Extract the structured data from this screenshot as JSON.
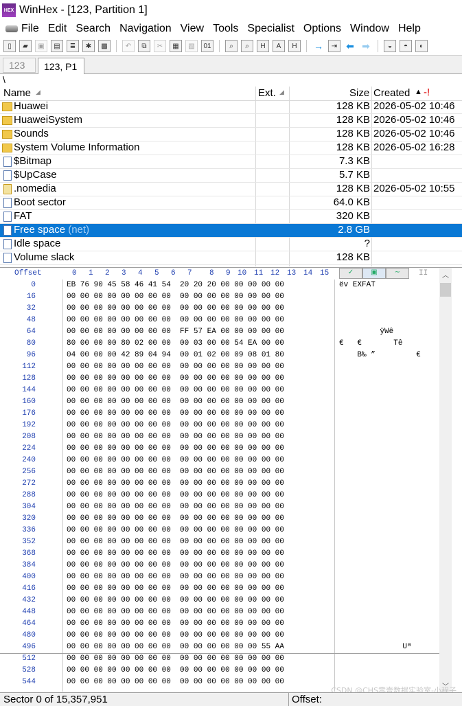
{
  "window": {
    "title": "WinHex - [123, Partition 1]",
    "app_icon_text": "HEX"
  },
  "menu": [
    "File",
    "Edit",
    "Search",
    "Navigation",
    "View",
    "Tools",
    "Specialist",
    "Options",
    "Window",
    "Help"
  ],
  "tabs": [
    {
      "label": "123",
      "active": false
    },
    {
      "label": "123, P1",
      "active": true
    }
  ],
  "path": "\\",
  "file_list": {
    "columns": {
      "name": "Name",
      "ext": "Ext.",
      "size": "Size",
      "created": "Created"
    },
    "rows": [
      {
        "name": "Huawei",
        "suffix": "",
        "size": "128 KB",
        "created": "2026-05-02  10:46",
        "icon": "folder-icon"
      },
      {
        "name": "HuaweiSystem",
        "suffix": "",
        "size": "128 KB",
        "created": "2026-05-02  10:46",
        "icon": "folder-icon"
      },
      {
        "name": "Sounds",
        "suffix": "",
        "size": "128 KB",
        "created": "2026-05-02  10:46",
        "icon": "folder-icon"
      },
      {
        "name": "System Volume Information",
        "suffix": "",
        "size": "128 KB",
        "created": "2026-05-02  16:28",
        "icon": "folder-icon"
      },
      {
        "name": "$Bitmap",
        "suffix": "",
        "size": "7.3 KB",
        "created": "",
        "icon": "file-icon"
      },
      {
        "name": "$UpCase",
        "suffix": "",
        "size": "5.7 KB",
        "created": "",
        "icon": "file-icon"
      },
      {
        "name": ".nomedia",
        "suffix": "",
        "size": "128 KB",
        "created": "2026-05-02  10:55",
        "icon": "nomedia-file-icon"
      },
      {
        "name": "Boot sector",
        "suffix": "",
        "size": "64.0 KB",
        "created": "",
        "icon": "file-icon"
      },
      {
        "name": "FAT",
        "suffix": "",
        "size": "320 KB",
        "created": "",
        "icon": "file-icon"
      },
      {
        "name": "Free space",
        "suffix": "(net)",
        "size": "2.8 GB",
        "created": "",
        "icon": "file-icon",
        "selected": true
      },
      {
        "name": "Idle space",
        "suffix": "",
        "size": "?",
        "created": "",
        "icon": "file-icon"
      },
      {
        "name": "Volume slack",
        "suffix": "",
        "size": "128 KB",
        "created": "",
        "icon": "file-icon"
      }
    ]
  },
  "hex": {
    "offset_label": "Offset",
    "column_labels": [
      "0",
      "1",
      "2",
      "3",
      "4",
      "5",
      "6",
      "7",
      "8",
      "9",
      "10",
      "11",
      "12",
      "13",
      "14",
      "15"
    ],
    "ascii_header": "II",
    "rows": [
      {
        "offset": "0",
        "bytes": "EB 76 90 45 58 46 41 54  20 20 20 00 00 00 00 00",
        "ascii": "ëv EXFAT"
      },
      {
        "offset": "16",
        "bytes": "00 00 00 00 00 00 00 00  00 00 00 00 00 00 00 00",
        "ascii": ""
      },
      {
        "offset": "32",
        "bytes": "00 00 00 00 00 00 00 00  00 00 00 00 00 00 00 00",
        "ascii": ""
      },
      {
        "offset": "48",
        "bytes": "00 00 00 00 00 00 00 00  00 00 00 00 00 00 00 00",
        "ascii": ""
      },
      {
        "offset": "64",
        "bytes": "00 00 00 00 00 00 00 00  FF 57 EA 00 00 00 00 00",
        "ascii": "         ÿWê"
      },
      {
        "offset": "80",
        "bytes": "80 00 00 00 80 02 00 00  00 03 00 00 54 EA 00 00",
        "ascii": "€   €       Tê"
      },
      {
        "offset": "96",
        "bytes": "04 00 00 00 42 89 04 94  00 01 02 00 09 08 01 80",
        "ascii": "    B‰ ”         €"
      },
      {
        "offset": "112",
        "bytes": "00 00 00 00 00 00 00 00  00 00 00 00 00 00 00 00",
        "ascii": ""
      },
      {
        "offset": "128",
        "bytes": "00 00 00 00 00 00 00 00  00 00 00 00 00 00 00 00",
        "ascii": ""
      },
      {
        "offset": "144",
        "bytes": "00 00 00 00 00 00 00 00  00 00 00 00 00 00 00 00",
        "ascii": ""
      },
      {
        "offset": "160",
        "bytes": "00 00 00 00 00 00 00 00  00 00 00 00 00 00 00 00",
        "ascii": ""
      },
      {
        "offset": "176",
        "bytes": "00 00 00 00 00 00 00 00  00 00 00 00 00 00 00 00",
        "ascii": ""
      },
      {
        "offset": "192",
        "bytes": "00 00 00 00 00 00 00 00  00 00 00 00 00 00 00 00",
        "ascii": ""
      },
      {
        "offset": "208",
        "bytes": "00 00 00 00 00 00 00 00  00 00 00 00 00 00 00 00",
        "ascii": ""
      },
      {
        "offset": "224",
        "bytes": "00 00 00 00 00 00 00 00  00 00 00 00 00 00 00 00",
        "ascii": ""
      },
      {
        "offset": "240",
        "bytes": "00 00 00 00 00 00 00 00  00 00 00 00 00 00 00 00",
        "ascii": ""
      },
      {
        "offset": "256",
        "bytes": "00 00 00 00 00 00 00 00  00 00 00 00 00 00 00 00",
        "ascii": ""
      },
      {
        "offset": "272",
        "bytes": "00 00 00 00 00 00 00 00  00 00 00 00 00 00 00 00",
        "ascii": ""
      },
      {
        "offset": "288",
        "bytes": "00 00 00 00 00 00 00 00  00 00 00 00 00 00 00 00",
        "ascii": ""
      },
      {
        "offset": "304",
        "bytes": "00 00 00 00 00 00 00 00  00 00 00 00 00 00 00 00",
        "ascii": ""
      },
      {
        "offset": "320",
        "bytes": "00 00 00 00 00 00 00 00  00 00 00 00 00 00 00 00",
        "ascii": ""
      },
      {
        "offset": "336",
        "bytes": "00 00 00 00 00 00 00 00  00 00 00 00 00 00 00 00",
        "ascii": ""
      },
      {
        "offset": "352",
        "bytes": "00 00 00 00 00 00 00 00  00 00 00 00 00 00 00 00",
        "ascii": ""
      },
      {
        "offset": "368",
        "bytes": "00 00 00 00 00 00 00 00  00 00 00 00 00 00 00 00",
        "ascii": ""
      },
      {
        "offset": "384",
        "bytes": "00 00 00 00 00 00 00 00  00 00 00 00 00 00 00 00",
        "ascii": ""
      },
      {
        "offset": "400",
        "bytes": "00 00 00 00 00 00 00 00  00 00 00 00 00 00 00 00",
        "ascii": ""
      },
      {
        "offset": "416",
        "bytes": "00 00 00 00 00 00 00 00  00 00 00 00 00 00 00 00",
        "ascii": ""
      },
      {
        "offset": "432",
        "bytes": "00 00 00 00 00 00 00 00  00 00 00 00 00 00 00 00",
        "ascii": ""
      },
      {
        "offset": "448",
        "bytes": "00 00 00 00 00 00 00 00  00 00 00 00 00 00 00 00",
        "ascii": ""
      },
      {
        "offset": "464",
        "bytes": "00 00 00 00 00 00 00 00  00 00 00 00 00 00 00 00",
        "ascii": ""
      },
      {
        "offset": "480",
        "bytes": "00 00 00 00 00 00 00 00  00 00 00 00 00 00 00 00",
        "ascii": ""
      },
      {
        "offset": "496",
        "bytes": "00 00 00 00 00 00 00 00  00 00 00 00 00 00 55 AA",
        "ascii": "              Uª"
      },
      {
        "offset": "512",
        "bytes": "00 00 00 00 00 00 00 00  00 00 00 00 00 00 00 00",
        "ascii": ""
      },
      {
        "offset": "528",
        "bytes": "00 00 00 00 00 00 00 00  00 00 00 00 00 00 00 00",
        "ascii": ""
      },
      {
        "offset": "544",
        "bytes": "00 00 00 00 00 00 00 00  00 00 00 00 00 00 00 00",
        "ascii": ""
      }
    ]
  },
  "status": {
    "left": "Sector 0 of 15,357,951",
    "right": "Offset:"
  },
  "watermark": "CSDN @CHS零壹数据实验室-小程子",
  "colors": {
    "selection": "#0a78d4",
    "offset_blue": "#1f3fb0",
    "folder": "#f1c84b"
  }
}
